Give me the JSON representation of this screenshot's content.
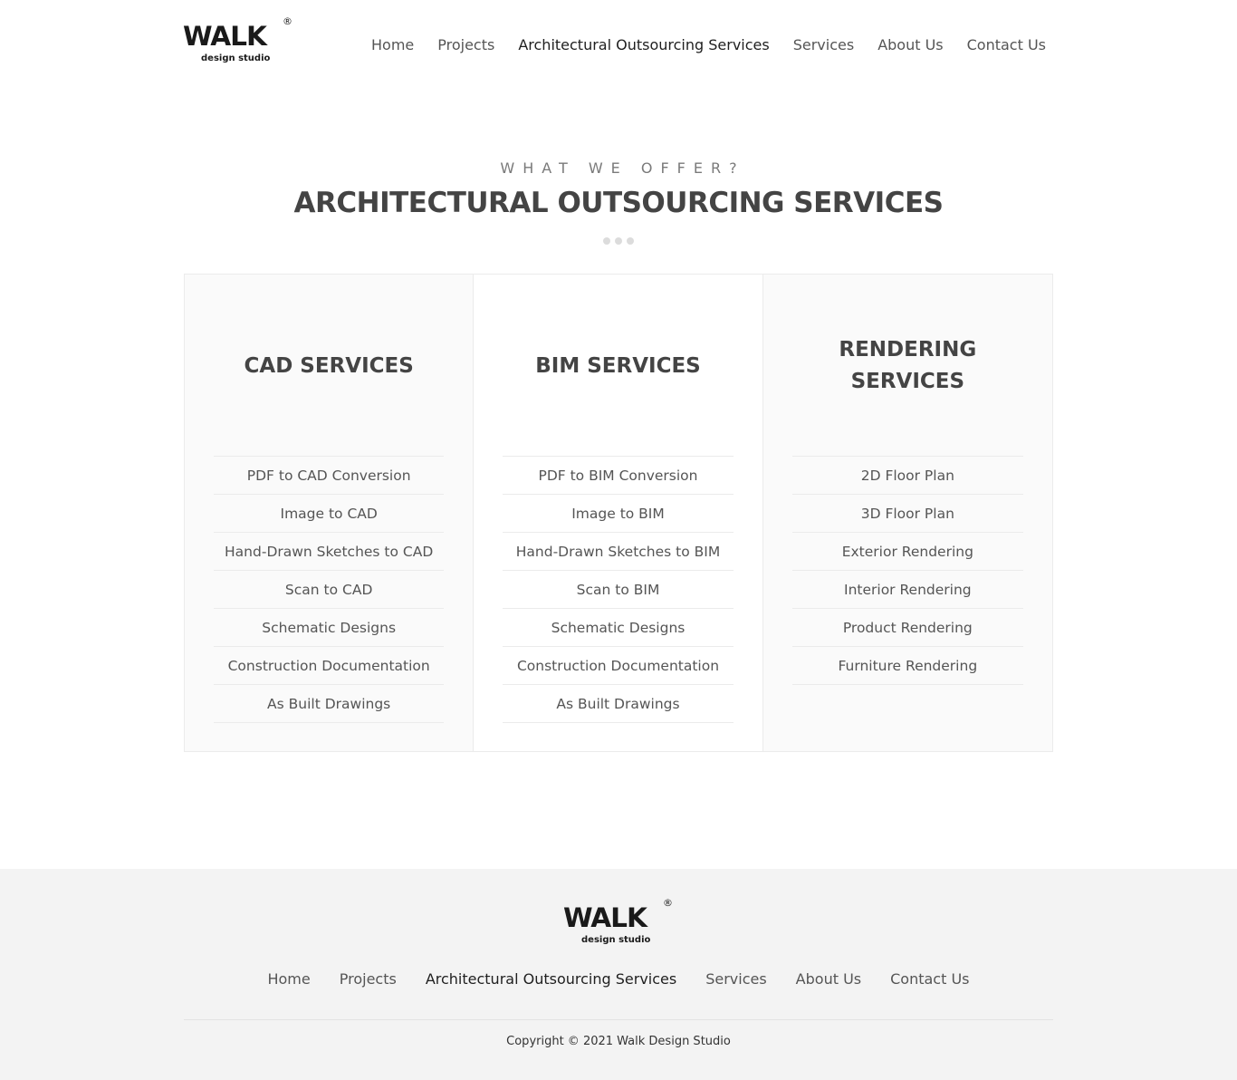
{
  "brand": {
    "name": "WALK",
    "tagline": "design studio",
    "registered": "®"
  },
  "nav": {
    "items": [
      {
        "label": "Home"
      },
      {
        "label": "Projects"
      },
      {
        "label": "Architectural Outsourcing Services",
        "active": true
      },
      {
        "label": "Services"
      },
      {
        "label": "About Us"
      },
      {
        "label": "Contact Us"
      }
    ]
  },
  "section": {
    "eyebrow": "WHAT WE OFFER?",
    "title": "ARCHITECTURAL OUTSOURCING SERVICES"
  },
  "columns": [
    {
      "title": "CAD SERVICES",
      "items": [
        "PDF to CAD Conversion",
        "Image to CAD",
        "Hand-Drawn Sketches to CAD",
        "Scan to CAD",
        "Schematic Designs",
        "Construction Documentation",
        "As Built Drawings"
      ]
    },
    {
      "title": "BIM SERVICES",
      "items": [
        "PDF to BIM Conversion",
        "Image to BIM",
        "Hand-Drawn Sketches to BIM",
        "Scan to BIM",
        "Schematic Designs",
        "Construction Documentation",
        "As Built Drawings"
      ]
    },
    {
      "title": "RENDERING SERVICES",
      "items": [
        "2D Floor Plan",
        "3D Floor Plan",
        "Exterior Rendering",
        "Interior Rendering",
        "Product Rendering",
        "Furniture Rendering"
      ]
    }
  ],
  "footer": {
    "copyright": "Copyright © 2021 Walk Design Studio"
  },
  "colors": {
    "text_dark": "#444444",
    "text_muted": "#7a7a7a",
    "footer_bg": "#f3f3f3",
    "panel_bg": "#fafafa",
    "divider": "#ebebeb"
  }
}
